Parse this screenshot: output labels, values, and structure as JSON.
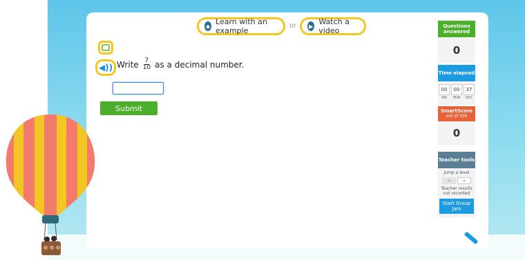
{
  "learn": {
    "example_label": "Learn with an example",
    "or_label": "or",
    "video_label": "Watch a video"
  },
  "question": {
    "prefix": "Write",
    "numerator": "7",
    "denominator": "10",
    "suffix": "as a decimal number.",
    "answer_value": ""
  },
  "submit_label": "Submit",
  "sidebar": {
    "questions_answered_label": "Questions answered",
    "questions_answered_value": "0",
    "time_elapsed_label": "Time elapsed",
    "time": {
      "hr": "00",
      "min": "00",
      "sec": "37"
    },
    "time_units": {
      "hr": "HR",
      "min": "MIN",
      "sec": "SEC"
    },
    "smartscore_label": "SmartScore",
    "smartscore_sub": "out of 100",
    "smartscore_value": "0",
    "teacher_tools_label": "Teacher tools",
    "jump_label": "Jump a level",
    "jump_prev": "«",
    "jump_next": "»",
    "teacher_note": "Teacher results not recorded",
    "group_jam_label": "Start Group Jam"
  },
  "colors": {
    "green": "#4caf2c",
    "blue": "#1e9be0",
    "orange": "#e8633a",
    "slate": "#5a7f95",
    "highlight": "#f3c623"
  }
}
